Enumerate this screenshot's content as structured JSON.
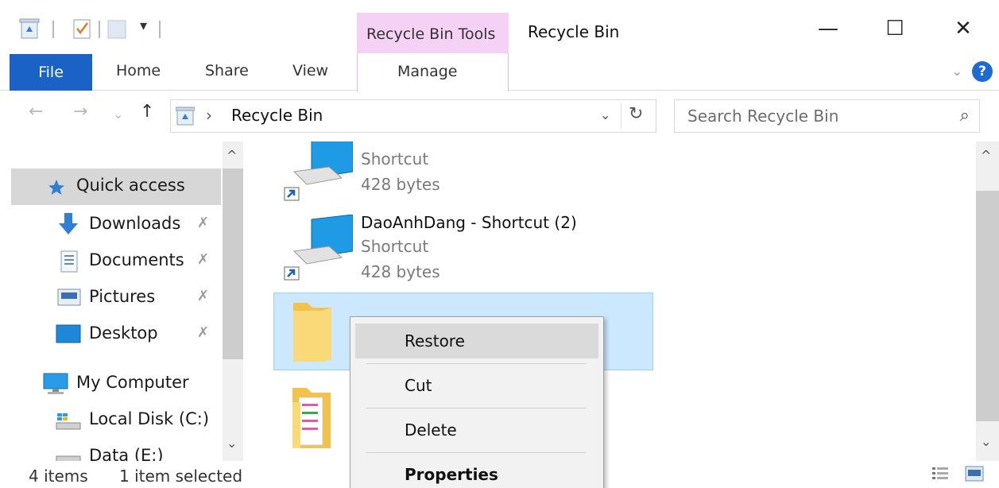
{
  "window": {
    "title": "Recycle Bin",
    "contextual_group": "Recycle Bin Tools",
    "minimize": "—",
    "maximize": "☐",
    "close": "✕"
  },
  "ribbon": {
    "tabs": [
      "File",
      "Home",
      "Share",
      "View",
      "Manage"
    ],
    "expand": "⌄",
    "help": "?"
  },
  "address": {
    "nav_back": "←",
    "nav_forward": "→",
    "recent": "⌄",
    "up": "↑",
    "separator": "›",
    "path": "Recycle Bin",
    "dropdown": "⌄",
    "refresh": "↻"
  },
  "search": {
    "placeholder": "Search Recycle Bin",
    "icon": "⌕"
  },
  "nav": {
    "items": [
      {
        "label": "Quick access",
        "icon": "star-icon"
      },
      {
        "label": "Downloads",
        "icon": "download-icon",
        "pinned": true
      },
      {
        "label": "Documents",
        "icon": "documents-icon",
        "pinned": true
      },
      {
        "label": "Pictures",
        "icon": "pictures-icon",
        "pinned": true
      },
      {
        "label": "Desktop",
        "icon": "desktop-icon",
        "pinned": true
      },
      {
        "label": "My Computer",
        "icon": "computer-icon"
      },
      {
        "label": "Local Disk (C:)",
        "icon": "drive-icon"
      },
      {
        "label": "Data (E:)",
        "icon": "drive-icon"
      }
    ],
    "pin_glyph": "✗",
    "scroll_up": "^",
    "scroll_down": "⌄"
  },
  "files": [
    {
      "name": "",
      "type": "Shortcut",
      "size": "428 bytes"
    },
    {
      "name": "DaoAnhDang - Shortcut (2)",
      "type": "Shortcut",
      "size": "428 bytes"
    },
    {
      "name": "",
      "type": "",
      "size": ""
    },
    {
      "name": "",
      "type": "",
      "size": ""
    }
  ],
  "scroll": {
    "up": "^",
    "down": "⌄"
  },
  "status": {
    "count": "4 items",
    "selection": "1 item selected"
  },
  "context_menu": {
    "items": [
      "Restore",
      "Cut",
      "Delete",
      "Properties"
    ]
  },
  "colors": {
    "file_tab": "#1a62c5",
    "contextual_tab": "#f5d2f5",
    "selection": "#cce8ff",
    "help": "#1e6ad3"
  }
}
